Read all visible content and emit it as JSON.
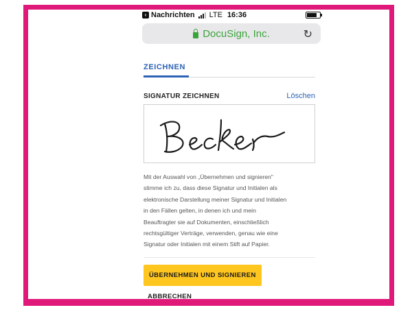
{
  "status_bar": {
    "back_app": "Nachrichten",
    "network": "LTE",
    "time": "16:36"
  },
  "browser": {
    "url_site": "DocuSign, Inc."
  },
  "tab": {
    "label": "ZEICHNEN"
  },
  "signature": {
    "title": "SIGNATUR ZEICHNEN",
    "clear_label": "Löschen",
    "drawn_name": "Becker"
  },
  "legal_lines": [
    "Mit der Auswahl von „Übernehmen und signieren\"",
    "stimme ich zu, dass diese Signatur und Initialen als",
    "elektronische Darstellung meiner Signatur und Initialen",
    "in den Fällen gelten, in denen ich und mein",
    "Beauftragter sie auf Dokumenten, einschließlich",
    "rechtsgültiger Verträge, verwenden, genau wie eine",
    "Signatur oder Initialen mit einem Stift auf Papier."
  ],
  "actions": {
    "primary_label": "ÜBERNEHMEN UND SIGNIEREN",
    "secondary_label": "ABBRECHEN"
  },
  "colors": {
    "frame": "#e0187a",
    "accent_blue": "#2b62b5",
    "primary_button": "#ffc620",
    "secure_green": "#3aa33a"
  }
}
